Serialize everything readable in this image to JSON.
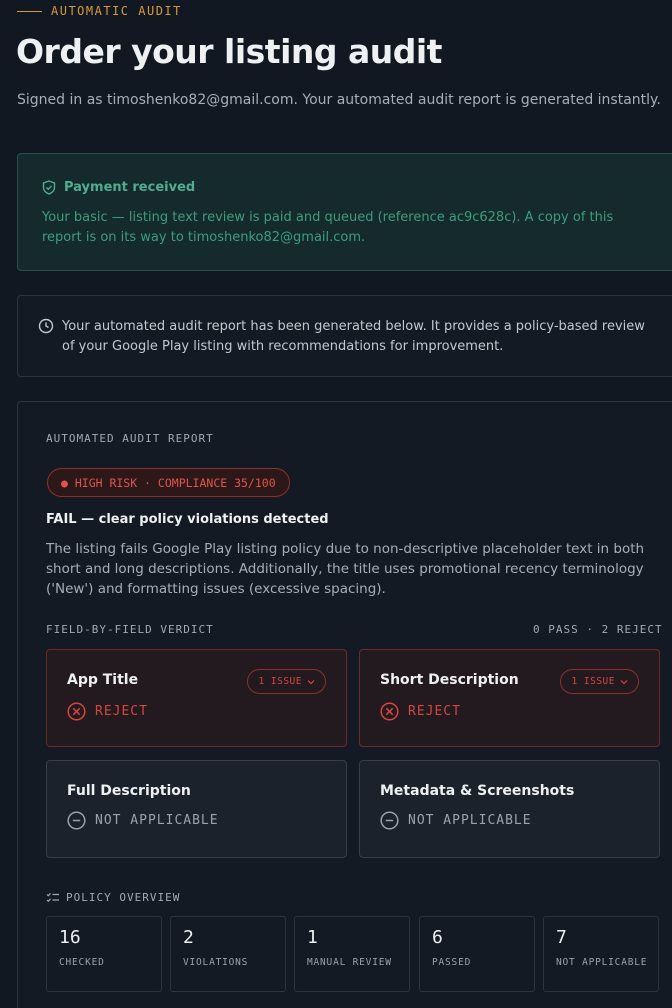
{
  "header": {
    "eyebrow": "AUTOMATIC AUDIT",
    "title": "Order your listing audit",
    "signed_in": "Signed in as timoshenko82@gmail.com. Your automated audit report is generated instantly."
  },
  "payment": {
    "title": "Payment received",
    "text": "Your basic — listing text review is paid and queued (reference ac9c628c). A copy of this report is on its way to timoshenko82@gmail.com.",
    "icon": "shield-check-icon",
    "color": "#4fae8c"
  },
  "notice": {
    "icon": "clock-icon",
    "text": "Your automated audit report has been generated below. It provides a policy-based review of your Google Play listing with recommendations for improvement."
  },
  "report": {
    "label": "AUTOMATED AUDIT REPORT",
    "risk_badge": "● HIGH RISK · COMPLIANCE 35/100",
    "risk_color": "#e0544d",
    "fail_title": "FAIL — clear policy violations detected",
    "fail_text": "The listing fails Google Play listing policy due to non-descriptive placeholder text in both short and long descriptions. Additionally, the title uses promotional recency terminology ('New') and formatting issues (excessive spacing).",
    "verdict_label": "FIELD-BY-FIELD VERDICT",
    "verdict_count": "0 PASS · 2 REJECT",
    "fields": [
      {
        "title": "App Title",
        "status": "REJECT",
        "issues": "1 ISSUE"
      },
      {
        "title": "Short Description",
        "status": "REJECT",
        "issues": "1 ISSUE"
      },
      {
        "title": "Full Description",
        "status": "NOT APPLICABLE"
      },
      {
        "title": "Metadata & Screenshots",
        "status": "NOT APPLICABLE"
      }
    ],
    "policy_label": "POLICY OVERVIEW",
    "stats": [
      {
        "value": "16",
        "label": "CHECKED"
      },
      {
        "value": "2",
        "label": "VIOLATIONS"
      },
      {
        "value": "1",
        "label": "MANUAL REVIEW"
      },
      {
        "value": "6",
        "label": "PASSED"
      },
      {
        "value": "7",
        "label": "NOT APPLICABLE"
      }
    ]
  }
}
